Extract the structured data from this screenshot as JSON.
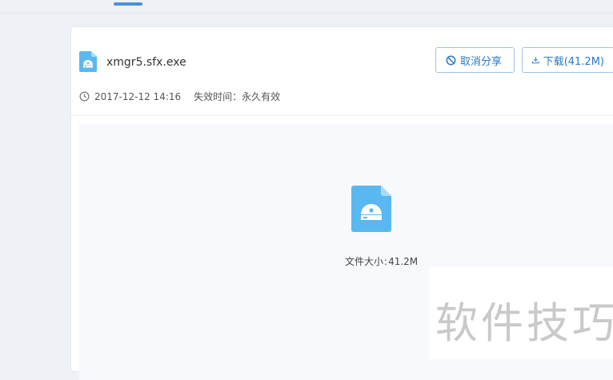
{
  "file": {
    "name": "xmgr5.sfx.exe",
    "date": "2017-12-12 14:16",
    "expire_label": "失效时间：",
    "expire_value": "永久有效",
    "size_label": "文件大小",
    "size_sep": ":",
    "size_value": "41.2M"
  },
  "actions": {
    "cancel_share": "取消分享",
    "download": "下载(41.2M)"
  },
  "watermark": "软件技巧",
  "colors": {
    "accent": "#2e78c7",
    "file_icon": "#5ab8f0",
    "tab_indicator": "#4a90d9"
  },
  "icons": [
    "clock-icon",
    "ban-icon",
    "download-icon",
    "file-exe-icon"
  ]
}
